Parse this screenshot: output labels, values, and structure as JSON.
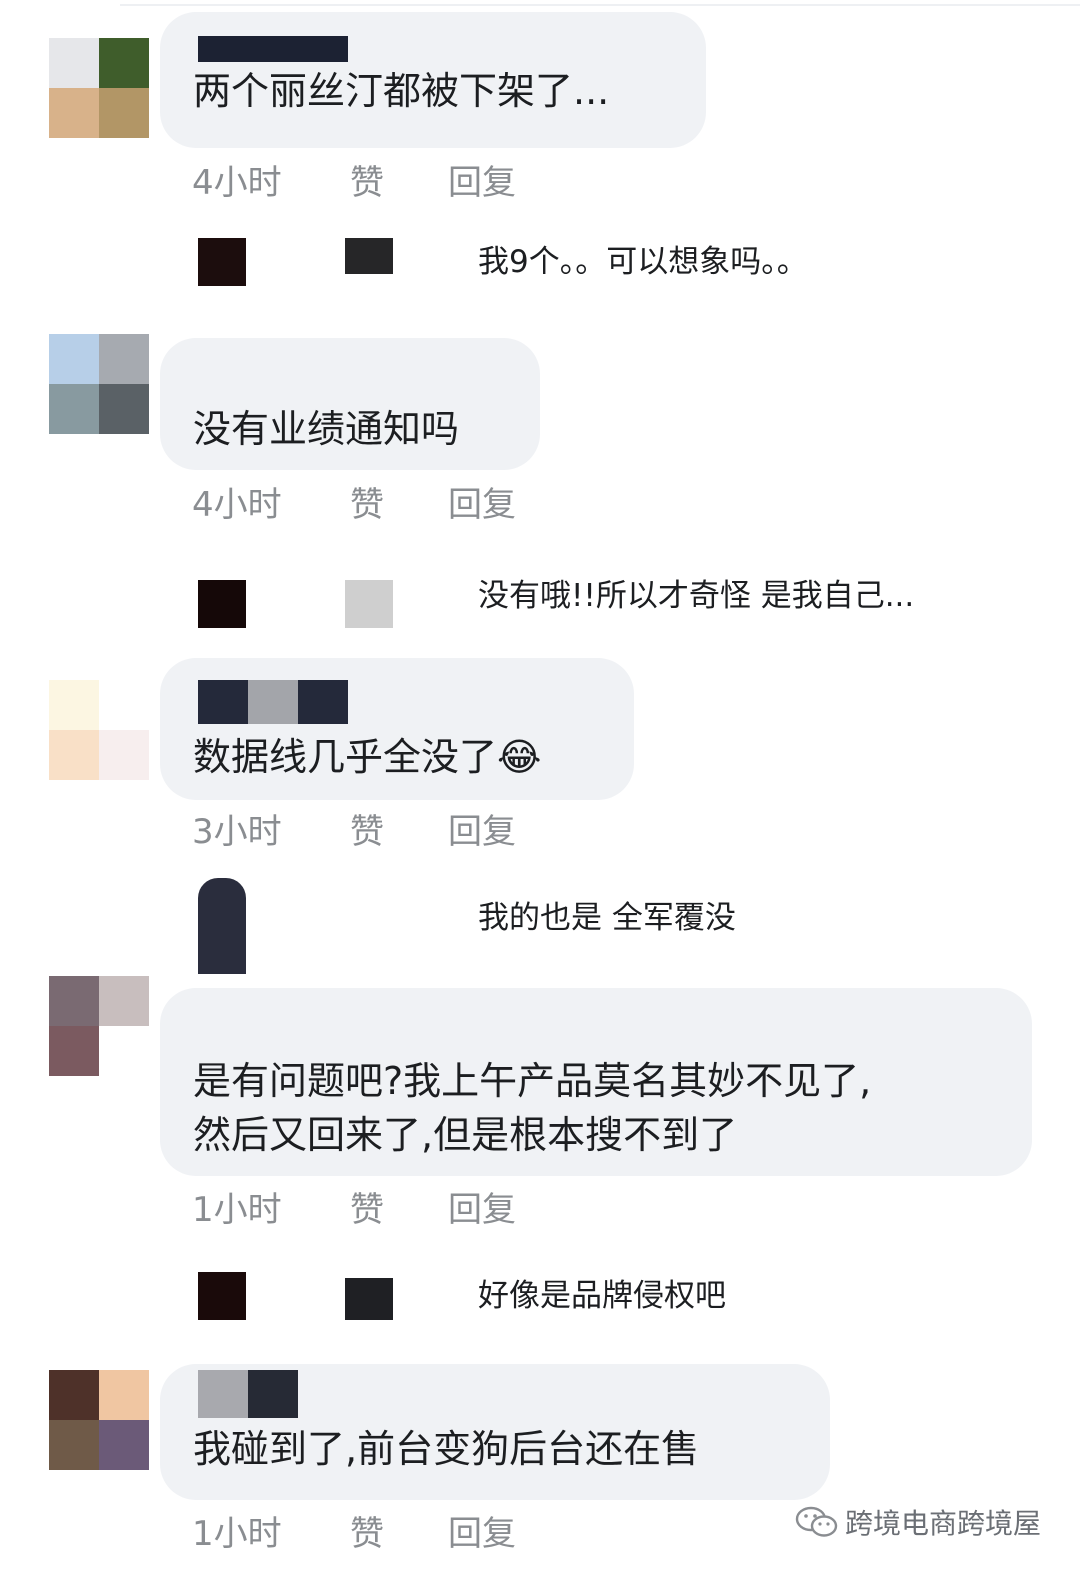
{
  "comments": [
    {
      "text_lines": [
        "两个丽丝汀都被下架了..."
      ],
      "time": "4小时",
      "like": "赞",
      "reply": "回复",
      "avatar_colors": [
        "#e6e7ea",
        "#3f5d2b",
        "#d8b28a",
        "#b29666"
      ],
      "name_blur_colors": [
        "#1c2233",
        "#1c2233",
        "#1c2233"
      ],
      "sub_reply": {
        "text": "我9个。。可以想象吗。。",
        "avatar_color": "#1c0d0d",
        "name_color": "#262628"
      }
    },
    {
      "text_lines": [
        "没有业绩通知吗"
      ],
      "time": "4小时",
      "like": "赞",
      "reply": "回复",
      "avatar_colors": [
        "#b7cfe8",
        "#a6aab0",
        "#889aa0",
        "#5a6166"
      ],
      "name_blur_colors": [],
      "sub_reply": {
        "text": "没有哦!!所以才奇怪 是我自己...",
        "avatar_color": "#150808",
        "name_color": "#cfcfcf"
      }
    },
    {
      "text_lines": [
        "数据线几乎全没了😂"
      ],
      "time": "3小时",
      "like": "赞",
      "reply": "回复",
      "avatar_colors": [
        "#fcf6e2",
        "#ffffff",
        "#f9e0c7",
        "#f7eeee"
      ],
      "name_blur_colors": [
        "#24293a",
        "#a3a5aa",
        "#24293a"
      ],
      "sub_reply": {
        "text": "我的也是 全军覆没",
        "avatar_color": "#2a2d3d",
        "name_color": "#ffffff"
      }
    },
    {
      "text_lines": [
        "是有问题吧?我上午产品莫名其妙不见了,",
        "然后又回来了,但是根本搜不到了"
      ],
      "time": "1小时",
      "like": "赞",
      "reply": "回复",
      "avatar_colors": [
        "#7a6a72",
        "#c8bebe",
        "#7b5a60",
        "#ffffff"
      ],
      "name_blur_colors": [],
      "sub_reply": {
        "text": "好像是品牌侵权吧",
        "avatar_color": "#1a0a0a",
        "name_color": "#1f2024"
      }
    },
    {
      "text_lines": [
        "我碰到了,前台变狗后台还在售"
      ],
      "time": "1小时",
      "like": "赞",
      "reply": "回复",
      "avatar_colors": [
        "#4e3129",
        "#f0c6a2",
        "#6f5a48",
        "#6b5a78"
      ],
      "name_blur_colors": [
        "#a8a9ae",
        "#262a35"
      ],
      "sub_reply": null
    }
  ],
  "watermark": {
    "text": "跨境电商跨境屋",
    "icon": "wechat-icon"
  }
}
